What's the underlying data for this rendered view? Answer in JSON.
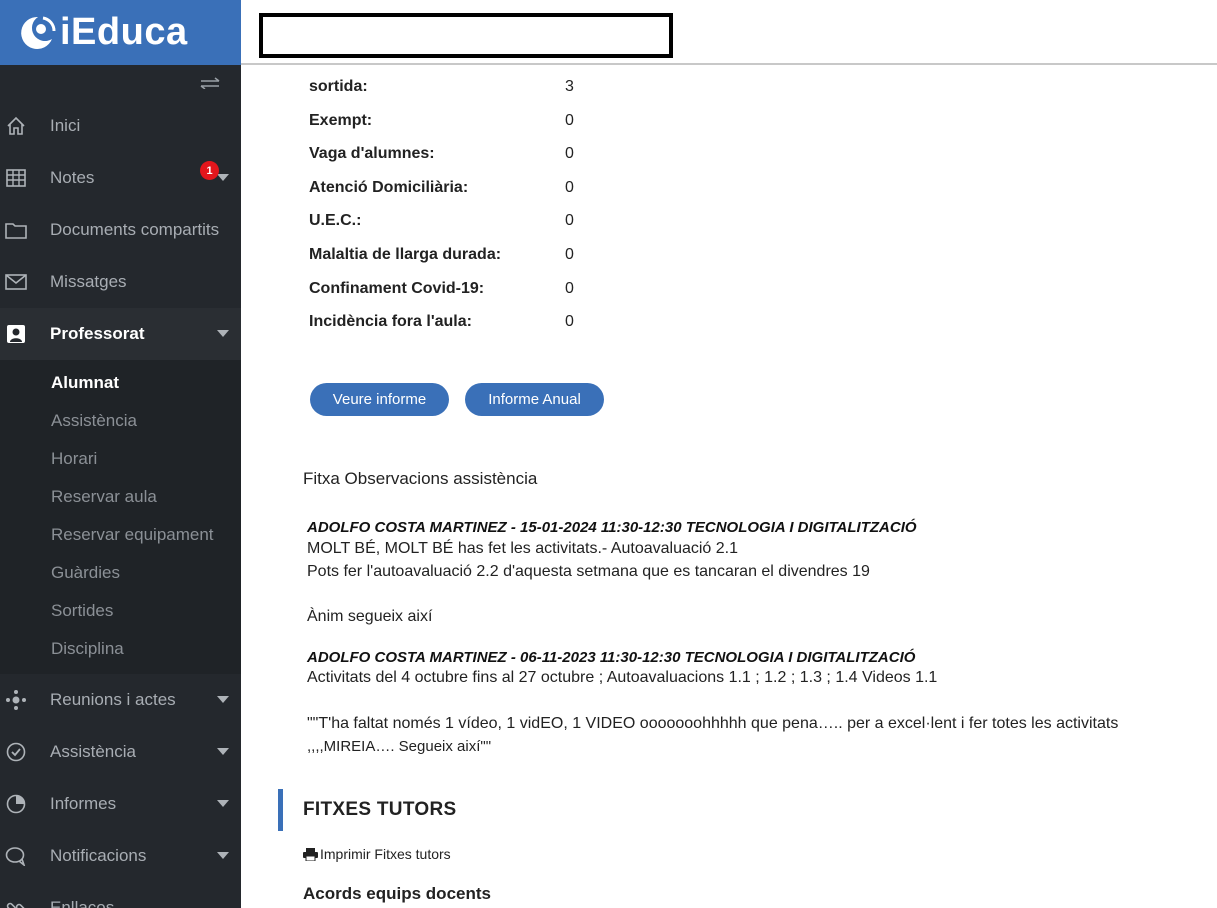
{
  "app": {
    "logo_text": "iEduca"
  },
  "sidebar": {
    "menu": [
      {
        "label": "Inici",
        "icon": "home-icon"
      },
      {
        "label": "Notes",
        "icon": "grid-icon"
      },
      {
        "label": "Documents compartits",
        "icon": "folder-icon"
      },
      {
        "label": "Missatges",
        "icon": "envelope-icon",
        "badge": "1"
      },
      {
        "label": "Professorat",
        "icon": "teacher-icon"
      }
    ],
    "submenu": [
      "Alumnat",
      "Assistència",
      "Horari",
      "Reservar aula",
      "Reservar equipament",
      "Guàrdies",
      "Sortides",
      "Disciplina"
    ],
    "menu2": [
      {
        "label": "Reunions i actes",
        "icon": "meeting-icon"
      },
      {
        "label": "Assistència",
        "icon": "check-circle-icon"
      },
      {
        "label": "Informes",
        "icon": "pie-chart-icon"
      },
      {
        "label": "Notificacions",
        "icon": "chat-icon"
      },
      {
        "label": "Enllaços",
        "icon": "link-icon"
      }
    ]
  },
  "stats": [
    {
      "label": "sortida:",
      "value": "3"
    },
    {
      "label": "Exempt:",
      "value": "0"
    },
    {
      "label": "Vaga d'alumnes:",
      "value": "0"
    },
    {
      "label": "Atenció Domiciliària:",
      "value": "0"
    },
    {
      "label": "U.E.C.:",
      "value": "0"
    },
    {
      "label": "Malaltia de llarga durada:",
      "value": "0"
    },
    {
      "label": "Confinament Covid-19:",
      "value": "0"
    },
    {
      "label": "Incidència fora l'aula:",
      "value": "0"
    }
  ],
  "buttons": {
    "veure_informe": "Veure informe",
    "informe_anual": "Informe Anual"
  },
  "observacions": {
    "title": "Fitxa Observacions assistència",
    "entry1": {
      "head": "ADOLFO COSTA MARTINEZ - 15-01-2024 11:30-12:30 TECNOLOGIA I DIGITALITZACIÓ",
      "line1": "MOLT BÉ, MOLT BÉ has fet les activitats.- Autoavaluació 2.1",
      "line2": "Pots fer l'autoavaluació 2.2 d'aquesta setmana que es tancaran el divendres 19",
      "line3": "Ànim segueix així"
    },
    "entry2": {
      "head": "ADOLFO COSTA MARTINEZ - 06-11-2023 11:30-12:30 TECNOLOGIA I DIGITALITZACIÓ",
      "line1": "Activitats del 4 octubre fins al 27 octubre ; Autoavaluacions 1.1 ; 1.2 ; 1.3 ; 1.4 Videos 1.1",
      "line2": "\"\"T'ha faltat només 1 vídeo, 1 vidEO, 1 VIDEO ooooooohhhhh que pena….. per a excel·lent i fer totes les activitats",
      "line3": ",,,,MIREIA…. Segueix així\"\""
    }
  },
  "tutors": {
    "title": "FITXES TUTORS",
    "print_label": "Imprimir Fitxes tutors",
    "acords": "Acords equips docents"
  }
}
